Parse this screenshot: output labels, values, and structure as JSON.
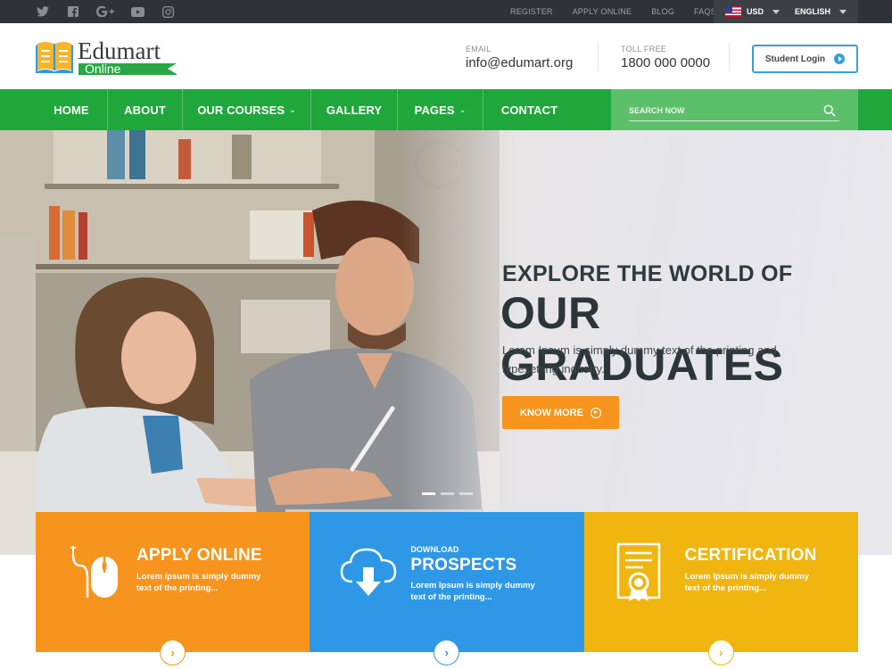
{
  "topbar": {
    "social_icons": [
      "twitter-icon",
      "facebook-icon",
      "google-plus-icon",
      "youtube-icon",
      "instagram-icon"
    ],
    "links": [
      "REGISTER",
      "APPLY ONLINE",
      "BLOG",
      "FAQS"
    ],
    "currency": "USD",
    "language": "ENGLISH"
  },
  "header": {
    "logo_name": "Edumart",
    "logo_sub": "Online",
    "email_label": "EMAIL",
    "email_value": "info@edumart.org",
    "phone_label": "TOLL FREE",
    "phone_value": "1800 000 0000",
    "login_label": "Student Login"
  },
  "nav": {
    "items": [
      {
        "label": "HOME",
        "dropdown": false
      },
      {
        "label": "ABOUT",
        "dropdown": false
      },
      {
        "label": "OUR COURSES",
        "dropdown": true
      },
      {
        "label": "GALLERY",
        "dropdown": false
      },
      {
        "label": "PAGES",
        "dropdown": true
      },
      {
        "label": "CONTACT",
        "dropdown": false
      }
    ],
    "search_placeholder": "SEARCH NOW"
  },
  "hero": {
    "title_line1": "EXPLORE THE WORLD OF",
    "title_line2": "OUR GRADUATES",
    "text": "Lorem Ipsum is simply dummy text of the printing and typesetting industry.",
    "button": "KNOW MORE",
    "slides": 3,
    "active_slide": 1
  },
  "features": [
    {
      "small": "",
      "title": "APPLY ONLINE",
      "desc": "Lorem ipsum is simply dummy text of the printing...",
      "color": "#f7941d",
      "icon": "mouse-icon"
    },
    {
      "small": "DOWNLOAD",
      "title": "PROSPECTS",
      "desc": "Lorem Ipsum is simply dummy text of the printing...",
      "color": "#2f98e6",
      "icon": "cloud-download-icon"
    },
    {
      "small": "",
      "title": "CERTIFICATION",
      "desc": "Lorem Ipsum is simply dummy text of the printing...",
      "color": "#f0b50f",
      "icon": "certificate-icon"
    }
  ],
  "colors": {
    "green": "#20a73b",
    "orange": "#f7941d",
    "blue": "#2f98e6",
    "yellow": "#f0b50f",
    "dark": "#2f3236"
  }
}
